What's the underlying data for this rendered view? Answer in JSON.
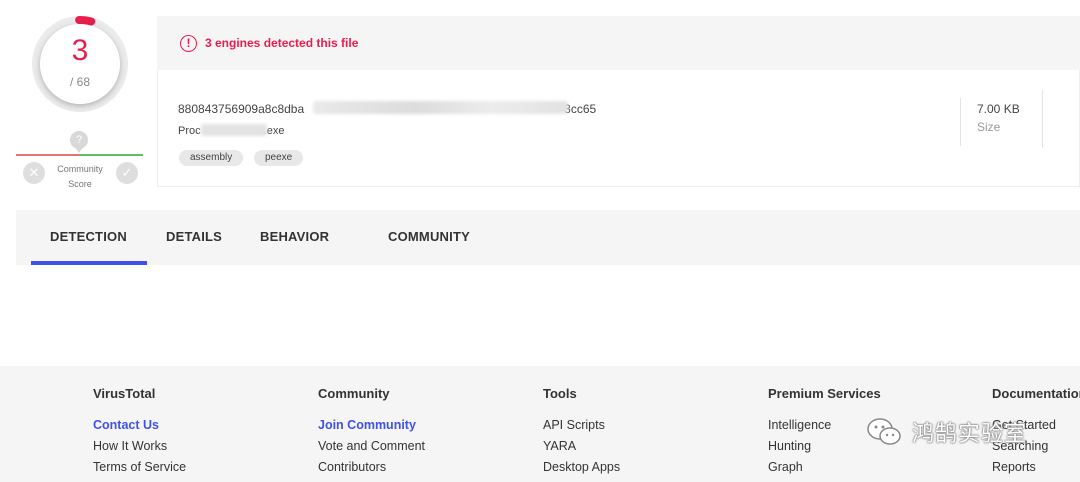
{
  "score": {
    "detections": "3",
    "total": "/ 68",
    "accent": "#e91e4d",
    "fraction": 0.0441
  },
  "community": {
    "pin_icon": "?",
    "label_line1": "Community",
    "label_line2": "Score",
    "down_icon": "✕",
    "up_icon": "✓"
  },
  "alert": {
    "icon": "!",
    "text": "3 engines detected this file"
  },
  "file": {
    "hash_visible": "88084375690 9a8c8dba",
    "hash_prefix": "88084375690",
    "hash_mid": "9a8c8dba",
    "hash_suffix": "3cc65",
    "name_prefix": "Proc",
    "name_suffix": "..exe",
    "tags": [
      "assembly",
      "peexe"
    ],
    "size_value": "7.00 KB",
    "size_label": "Size"
  },
  "tabs": [
    "DETECTION",
    "DETAILS",
    "BEHAVIOR",
    "COMMUNITY"
  ],
  "active_tab": "DETECTION",
  "footer": {
    "columns": [
      {
        "title": "VirusTotal",
        "links": [
          "Contact Us",
          "How It Works",
          "Terms of Service"
        ]
      },
      {
        "title": "Community",
        "links": [
          "Join Community",
          "Vote and Comment",
          "Contributors"
        ]
      },
      {
        "title": "Tools",
        "links": [
          "API Scripts",
          "YARA",
          "Desktop Apps"
        ]
      },
      {
        "title": "Premium Services",
        "links": [
          "Intelligence",
          "Hunting",
          "Graph"
        ]
      },
      {
        "title": "Documentation",
        "links": [
          "Get Started",
          "Searching",
          "Reports"
        ]
      }
    ]
  },
  "watermark": {
    "text": "鸿鹄实验室",
    "icon": "wechat-icon"
  }
}
